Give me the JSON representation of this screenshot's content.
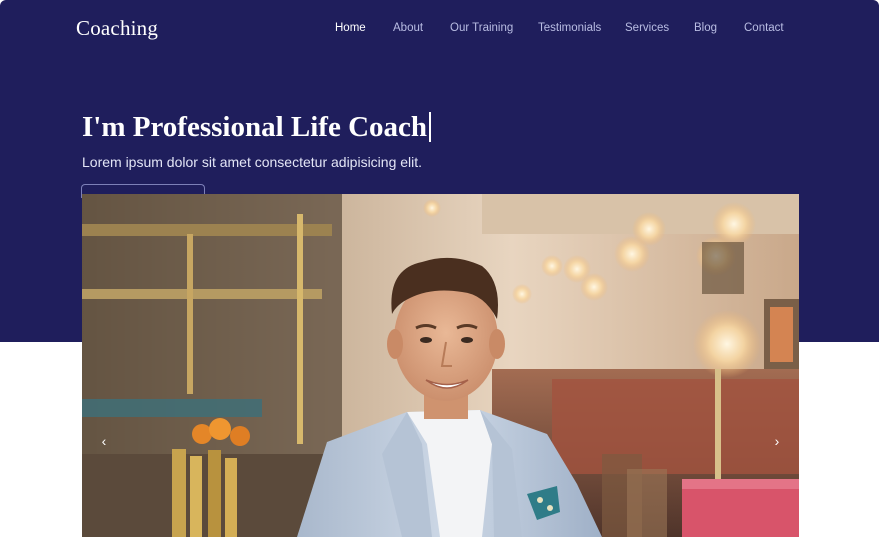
{
  "brand": {
    "name": "Coaching"
  },
  "nav": {
    "items": [
      {
        "label": "Home",
        "active": true
      },
      {
        "label": "About",
        "active": false
      },
      {
        "label": "Our Training",
        "active": false
      },
      {
        "label": "Testimonials",
        "active": false
      },
      {
        "label": "Services",
        "active": false
      },
      {
        "label": "Blog",
        "active": false
      },
      {
        "label": "Contact",
        "active": false
      }
    ]
  },
  "hero": {
    "headline": "I'm Professional Life Coach",
    "subtext": "Lorem ipsum dolor sit amet consectetur adipisicing elit."
  },
  "slider": {
    "prev_icon": "chevron-left-icon",
    "next_icon": "chevron-right-icon",
    "prev_glyph": "‹",
    "next_glyph": "›"
  },
  "colors": {
    "hero_background": "#1f1e5c",
    "nav_text": "#b9bde3",
    "nav_active": "#ffffff",
    "page_background": "#ffffff"
  }
}
